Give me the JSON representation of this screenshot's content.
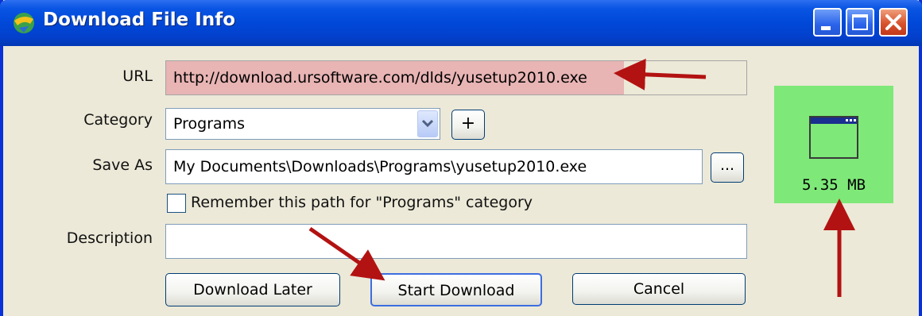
{
  "window": {
    "title": "Download File Info",
    "icon": "download-app-icon",
    "controls": [
      "minimize-icon",
      "maximize-icon",
      "close-icon"
    ],
    "accent_color": "#0048d8",
    "close_color": "#d8532d"
  },
  "form": {
    "url": {
      "label": "URL",
      "value": "http://download.ursoftware.com/dlds/yusetup2010.exe",
      "highlight_color": "#e8b4b4"
    },
    "category": {
      "label": "Category",
      "value": "Programs",
      "add_label": "+"
    },
    "save_as": {
      "label": "Save As",
      "value": "My Documents\\Downloads\\Programs\\yusetup2010.exe",
      "browse_label": "..."
    },
    "remember": {
      "label": "Remember this path for \"Programs\" category",
      "checked": false
    },
    "description": {
      "label": "Description",
      "value": ""
    }
  },
  "buttons": {
    "download_later": "Download Later",
    "start_download": "Start Download",
    "cancel": "Cancel"
  },
  "file_info": {
    "size": "5.35 MB",
    "icon": "application-window-icon",
    "panel_color": "#7ee878"
  },
  "annotations": {
    "arrow_color": "#b31212"
  }
}
